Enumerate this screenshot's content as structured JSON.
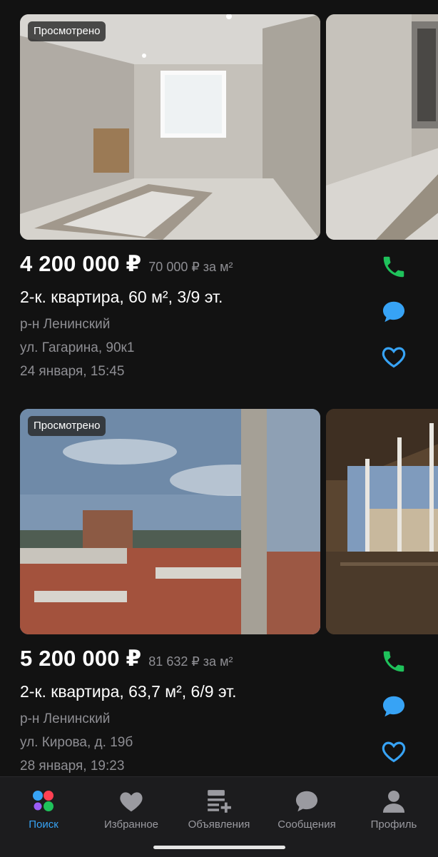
{
  "listings": [
    {
      "badge": "Просмотрено",
      "price": "4 200 000 ₽",
      "price_per_m2": "70 000 ₽ за м²",
      "title": "2-к. квартира, 60 м², 3/9 эт.",
      "district": "р-н Ленинский",
      "address": "ул. Гагарина, 90к1",
      "date": "24 января, 15:45"
    },
    {
      "badge": "Просмотрено",
      "price": "5 200 000 ₽",
      "price_per_m2": "81 632 ₽ за м²",
      "title": "2-к. квартира, 63,7 м², 6/9 эт.",
      "district": "р-н Ленинский",
      "address": "ул. Кирова, д. 19б",
      "date": "28 января, 19:23"
    }
  ],
  "tabbar": {
    "items": [
      {
        "label": "Поиск",
        "icon": "search-dots-icon",
        "active": true
      },
      {
        "label": "Избранное",
        "icon": "heart-icon",
        "active": false
      },
      {
        "label": "Объявления",
        "icon": "add-listing-icon",
        "active": false
      },
      {
        "label": "Сообщения",
        "icon": "message-bubble-icon",
        "active": false
      },
      {
        "label": "Профиль",
        "icon": "person-icon",
        "active": false
      }
    ]
  },
  "colors": {
    "background": "#121212",
    "tabbar": "#1c1c1e",
    "accent_blue": "#37a3f5",
    "call_green": "#1fc25b",
    "muted_text": "#8e8e93"
  }
}
